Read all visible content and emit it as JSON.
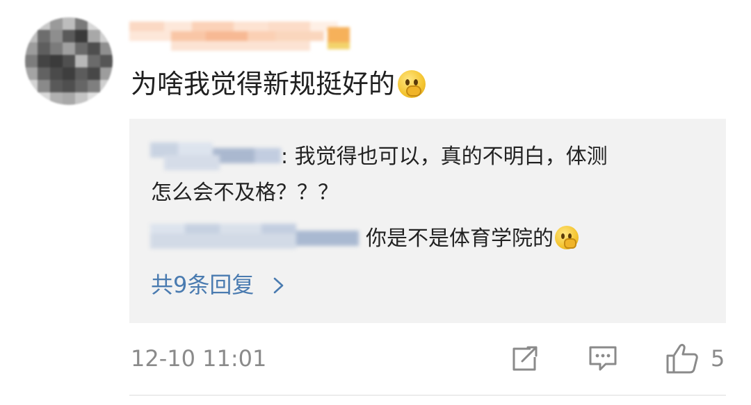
{
  "comment": {
    "text": "为啥我觉得新规挺好的",
    "emoji": "thinking-emoji"
  },
  "replies": [
    {
      "line1": ": 我觉得也可以，真的不明白，体测",
      "line2": "怎么会不及格？？？"
    },
    {
      "text": "你是不是体育学院的",
      "emoji": "thinking-emoji"
    }
  ],
  "more_replies_label": "共9条回复",
  "more_replies_chevron": "chevron-right-icon",
  "footer": {
    "timestamp": "12-10 11:01",
    "like_count": "5"
  },
  "colors": {
    "link": "#4a7bb0",
    "meta": "#8a8a8a",
    "reply_bg": "#f2f2f2",
    "text": "#222222"
  }
}
